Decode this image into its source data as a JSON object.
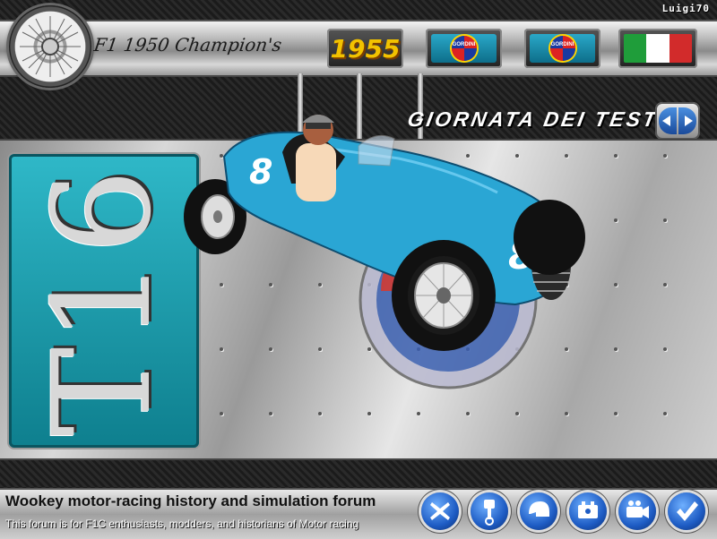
{
  "header": {
    "user_label": "Luigi70",
    "game_title": "F1 1950 Champion's",
    "year_badge": "1955",
    "team_badge_text": "GORDINI",
    "flag_colors": [
      "#1f9d3a",
      "#ffffff",
      "#d22b2b"
    ]
  },
  "section": {
    "title": "GIORNATA DEI TEST"
  },
  "car": {
    "model_label": "T16",
    "race_number": "8",
    "body_color": "#2aa6d4"
  },
  "footer": {
    "forum_title": "Wookey motor-racing history and simulation forum",
    "forum_subtitle": "This forum is for F1C enthusiasts, modders, and historians of Motor racing",
    "buttons": [
      {
        "icon": "close-x-icon"
      },
      {
        "icon": "piston-icon"
      },
      {
        "icon": "helmet-icon"
      },
      {
        "icon": "engine-icon"
      },
      {
        "icon": "camera-icon"
      },
      {
        "icon": "checkmark-icon"
      }
    ]
  },
  "colors": {
    "accent_blue": "#1e5cc4",
    "plate_teal": "#1a9eae"
  }
}
